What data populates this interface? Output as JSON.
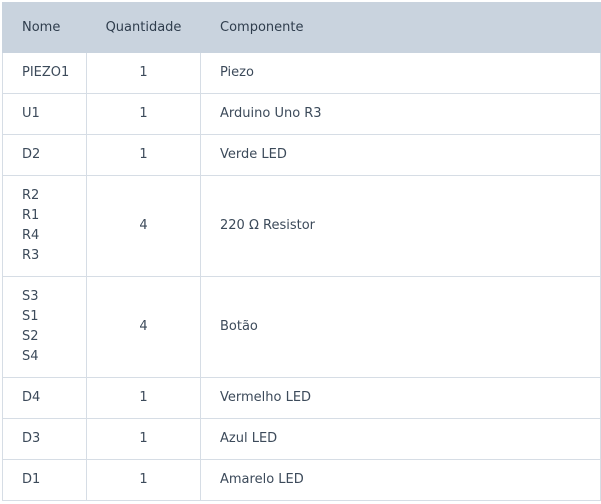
{
  "table": {
    "headers": {
      "name": "Nome",
      "quantity": "Quantidade",
      "component": "Componente"
    },
    "rows": [
      {
        "names": [
          "PIEZO1"
        ],
        "quantity": "1",
        "component": "Piezo"
      },
      {
        "names": [
          "U1"
        ],
        "quantity": "1",
        "component": "Arduino Uno R3"
      },
      {
        "names": [
          "D2"
        ],
        "quantity": "1",
        "component": "Verde LED"
      },
      {
        "names": [
          "R2",
          "R1",
          "R4",
          "R3"
        ],
        "quantity": "4",
        "component": "220 Ω Resistor"
      },
      {
        "names": [
          "S3",
          "S1",
          "S2",
          "S4"
        ],
        "quantity": "4",
        "component": "Botão"
      },
      {
        "names": [
          "D4"
        ],
        "quantity": "1",
        "component": "Vermelho LED"
      },
      {
        "names": [
          "D3"
        ],
        "quantity": "1",
        "component": "Azul LED"
      },
      {
        "names": [
          "D1"
        ],
        "quantity": "1",
        "component": "Amarelo LED"
      }
    ]
  },
  "colors": {
    "header_bg": "#c9d3de",
    "border": "#d6dde5",
    "text": "#3c4a5a"
  }
}
